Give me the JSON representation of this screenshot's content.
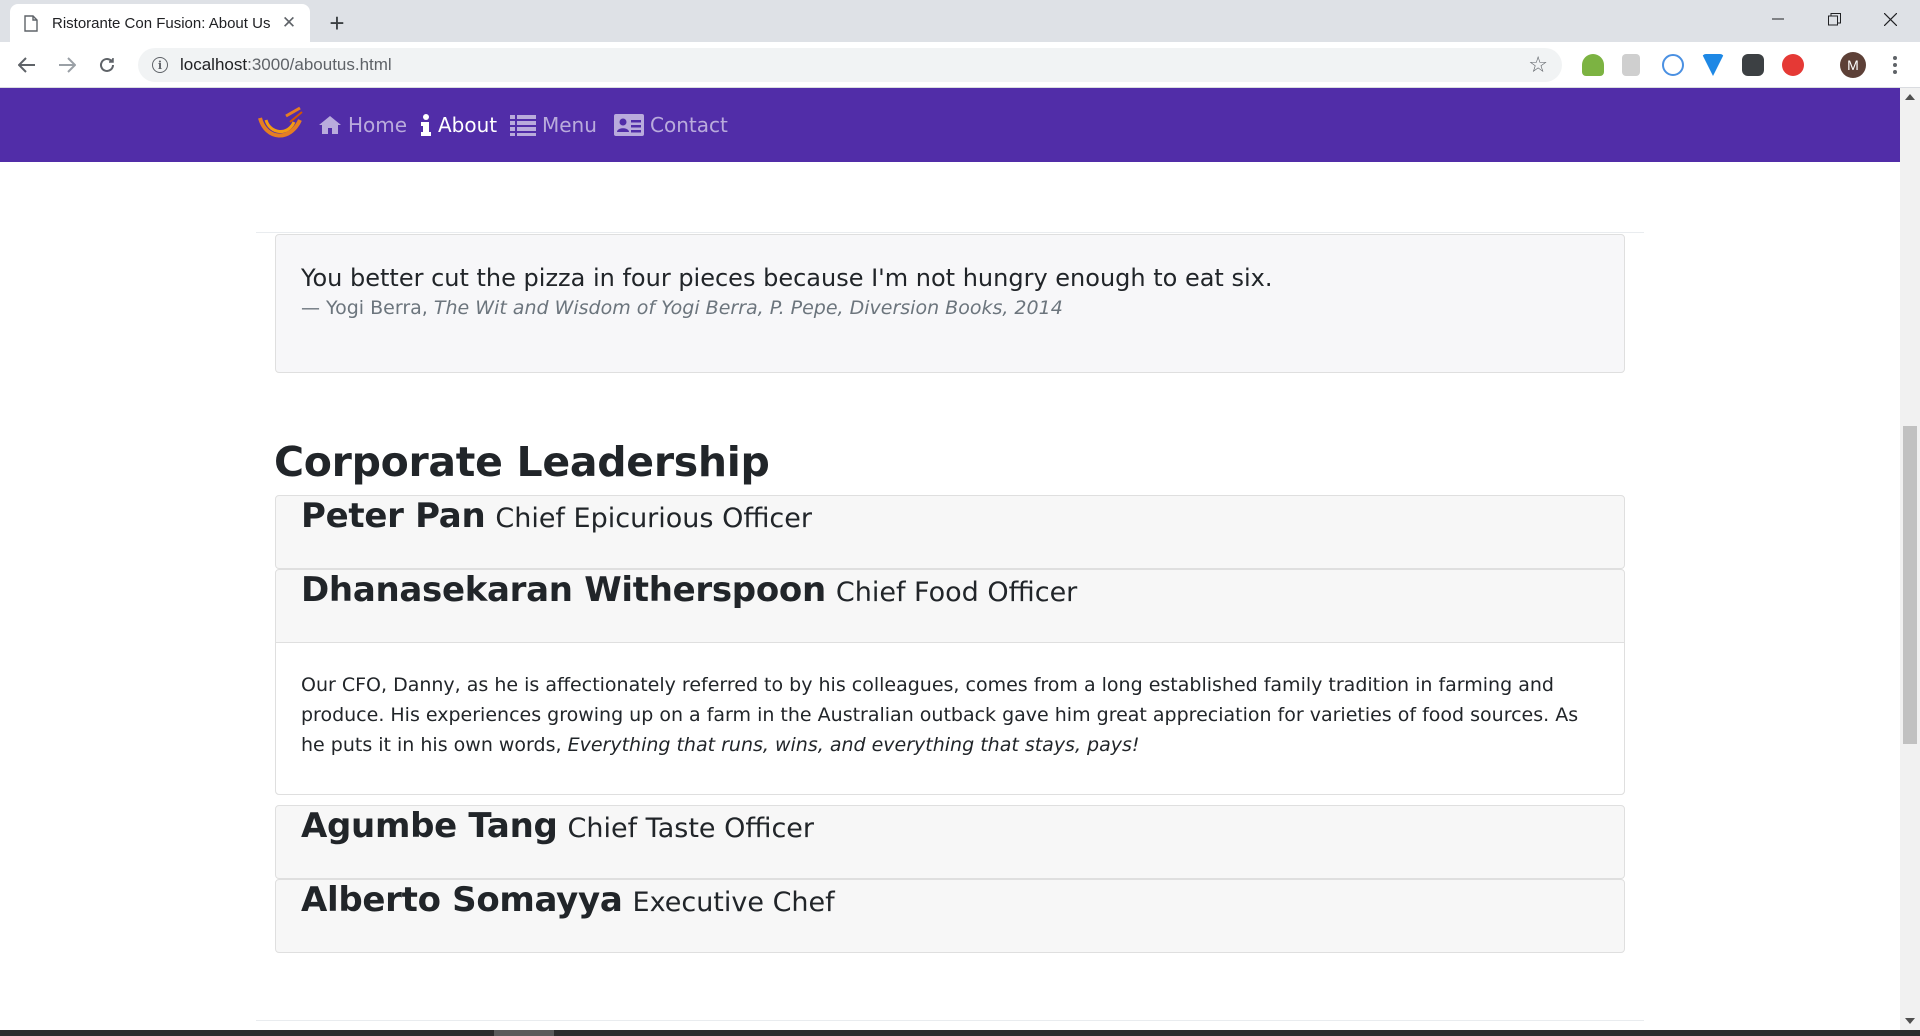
{
  "browser": {
    "tab_title": "Ristorante Con Fusion: About Us",
    "url_host": "localhost",
    "url_path": ":3000/aboutus.html",
    "profile_initial": "M",
    "icons": [
      "document-icon",
      "close-icon",
      "plus-icon",
      "back-icon",
      "forward-icon",
      "reload-icon",
      "info-icon",
      "star-icon",
      "kebab-menu-icon"
    ]
  },
  "navbar": {
    "background": "#512da8",
    "links": [
      {
        "label": "Home",
        "icon": "home-icon"
      },
      {
        "label": "About",
        "icon": "info-icon"
      },
      {
        "label": "Menu",
        "icon": "list-icon"
      },
      {
        "label": "Contact",
        "icon": "address-card-icon"
      }
    ],
    "active": "About"
  },
  "quote": {
    "text": "You better cut the pizza in four pieces because I'm not hungry enough to eat six.",
    "author": "— Yogi Berra, ",
    "source": "The Wit and Wisdom of Yogi Berra, P. Pepe, Diversion Books, 2014"
  },
  "leadership": {
    "title": "Corporate Leadership",
    "leaders": [
      {
        "name": "Peter Pan",
        "role": "Chief Epicurious Officer"
      },
      {
        "name": "Dhanasekaran Witherspoon",
        "role": "Chief Food Officer",
        "bio": "Our CFO, Danny, as he is affectionately referred to by his colleagues, comes from a long established family tradition in farming and produce. His experiences growing up on a farm in the Australian outback gave him great appreciation for varieties of food sources. As he puts it in his own words, ",
        "bio_quote": "Everything that runs, wins, and everything that stays, pays!"
      },
      {
        "name": "Agumbe Tang",
        "role": "Chief Taste Officer"
      },
      {
        "name": "Alberto Somayya",
        "role": "Executive Chef"
      }
    ]
  }
}
